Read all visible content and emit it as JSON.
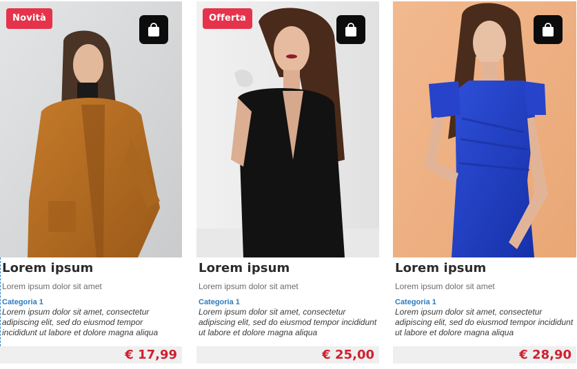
{
  "colors": {
    "badge": "#e5334b",
    "cart_button": "#0c0c0c",
    "title": "#2b2b2b",
    "category": "#2b7bbf",
    "price": "#d01f2e",
    "price_bar": "#efefef"
  },
  "products": [
    {
      "badge": "Novità",
      "title": "Lorem ipsum",
      "subtitle": "Lorem ipsum dolor sit amet",
      "category": "Categoria 1",
      "description": "Lorem ipsum dolor sit amet, consectetur adipiscing elit, sed do eiusmod tempor incididunt ut labore et dolore magna aliqua",
      "price": "€ 17,99",
      "cart_icon": "shopping-bag-icon"
    },
    {
      "badge": "Offerta",
      "title": "Lorem ipsum",
      "subtitle": "Lorem ipsum dolor sit amet",
      "category": "Categoria 1",
      "description": "Lorem ipsum dolor sit amet, consectetur adipiscing elit, sed do eiusmod tempor incididunt ut labore et dolore magna aliqua",
      "price": "€ 25,00",
      "cart_icon": "shopping-bag-icon"
    },
    {
      "title": "Lorem ipsum",
      "subtitle": "Lorem ipsum dolor sit amet",
      "category": "Categoria 1",
      "description": "Lorem ipsum dolor sit amet, consectetur adipiscing elit, sed do eiusmod tempor incididunt ut labore et dolore magna aliqua",
      "price": "€ 28,90",
      "cart_icon": "shopping-bag-icon"
    }
  ]
}
